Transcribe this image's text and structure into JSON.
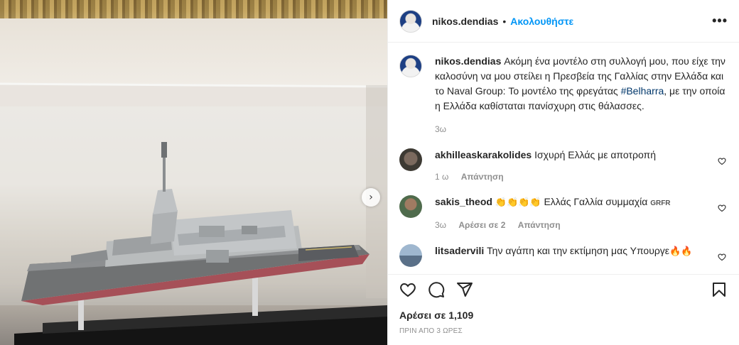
{
  "post": {
    "username": "nikos.dendias",
    "follow_label": "Ακολουθήστε",
    "separator": "•",
    "more_label": "•••",
    "caption_prefix": "Ακόμη ένα μοντέλο στη συλλογή μου, που είχε την καλοσύνη να μου στείλει η Πρεσβεία της Γαλλίας στην Ελλάδα και το Naval Group: Το μοντέλο της φρεγάτας ",
    "caption_hashtag": "#Belharra",
    "caption_suffix": ", με την οποία η Ελλάδα καθίσταται πανίσχυρη στις θάλασσες.",
    "caption_age": "3ω"
  },
  "comments": [
    {
      "username": "akhilleaskarakolides",
      "text": "Ισχυρή Ελλάς με αποτροπή",
      "age": "1 ω",
      "likes": "",
      "reply": "Απάντηση"
    },
    {
      "username": "sakis_theod",
      "emojis": "👏👏👏👏",
      "text": "Ελλάς Γαλλία συμμαχία",
      "flag": "GRFR",
      "age": "3ω",
      "likes": "Αρέσει σε 2",
      "reply": "Απάντηση"
    },
    {
      "username": "litsadervili",
      "text": "Την αγάπη και την εκτίμηση μας Υπουργε",
      "emojis": "🔥🔥"
    }
  ],
  "footer": {
    "likes_text": "Αρέσει σε 1,109",
    "timestamp": "ΠΡΙΝ ΑΠΟ 3 ΩΡΕΣ"
  },
  "icons": {
    "like": "heart-icon",
    "comment": "comment-icon",
    "share": "share-icon",
    "save": "bookmark-icon",
    "next": "chevron-right-icon"
  },
  "colors": {
    "link": "#0095f6",
    "hashtag": "#00376b",
    "muted": "#8e8e8e",
    "text": "#262626"
  }
}
